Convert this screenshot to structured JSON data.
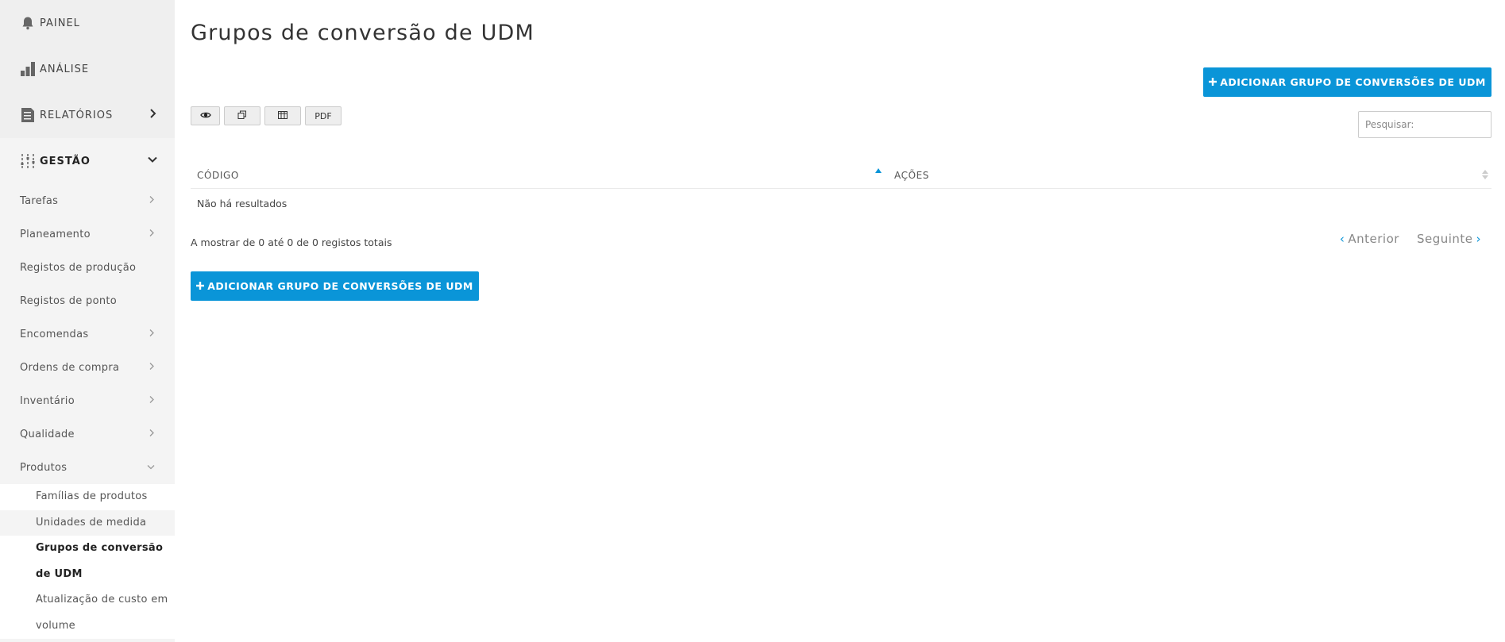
{
  "sidebar": {
    "top_items": [
      {
        "label": "PAINEL",
        "icon": "bell-icon"
      },
      {
        "label": "ANÁLISE",
        "icon": "bar-chart-icon"
      },
      {
        "label": "RELATÓRIOS",
        "icon": "report-icon"
      },
      {
        "label": "GESTÃO",
        "icon": "sliders-icon"
      }
    ],
    "sub_items": [
      {
        "label": "Tarefas"
      },
      {
        "label": "Planeamento"
      },
      {
        "label": "Registos de produção"
      },
      {
        "label": "Registos de ponto"
      },
      {
        "label": "Encomendas"
      },
      {
        "label": "Ordens de compra"
      },
      {
        "label": "Inventário"
      },
      {
        "label": "Qualidade"
      },
      {
        "label": "Produtos"
      }
    ],
    "product_items": [
      {
        "label": "Famílias de produtos"
      },
      {
        "label": "Unidades de medida"
      },
      {
        "label": "Grupos de conversão de UDM"
      },
      {
        "label": "Atualização de custo em volume"
      }
    ]
  },
  "page": {
    "title": "Grupos de conversão de UDM",
    "add_button_label": "ADICIONAR GRUPO DE CONVERSÕES DE UDM",
    "pdf_label": "PDF",
    "search_placeholder": "Pesquisar:"
  },
  "table": {
    "columns": [
      "CÓDIGO",
      "AÇÕES"
    ],
    "empty_text": "Não há resultados",
    "info": "A mostrar de 0 até 0 de 0 registos totais"
  },
  "pager": {
    "prev": "Anterior",
    "next": "Seguinte"
  },
  "colors": {
    "accent": "#0a95d8",
    "sidebar_bg": "#f4f4f4"
  }
}
